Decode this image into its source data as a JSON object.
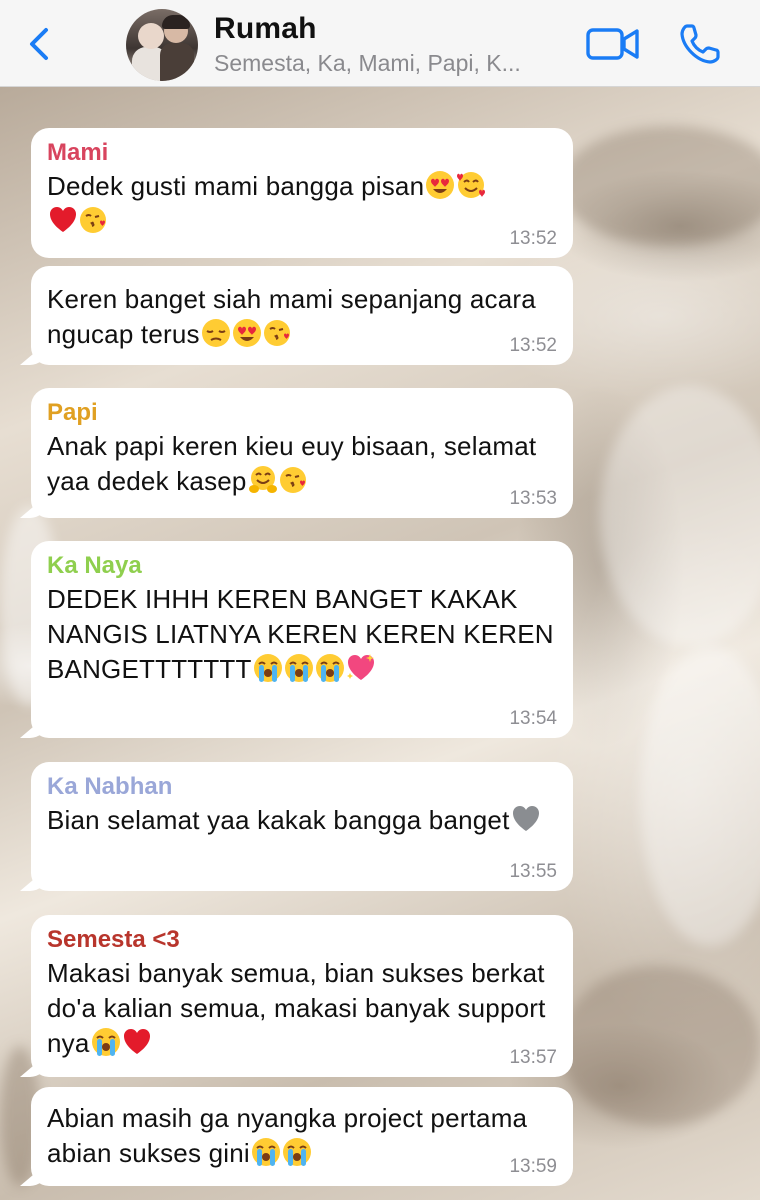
{
  "header": {
    "back_icon": "chevron-left-icon",
    "title": "Rumah",
    "subtitle": "Semesta, Ka, Mami, Papi, K...",
    "video_icon": "video-camera-icon",
    "call_icon": "phone-icon",
    "accent_color": "#1a7cf5"
  },
  "messages": [
    {
      "sender": "Mami",
      "sender_color": "#d8445e",
      "text": "Dedek gusti mami bangga pisan",
      "emojis": [
        "heart-eyes",
        "smiling-hearts",
        "red-heart",
        "kissing-heart"
      ],
      "time": "13:52"
    },
    {
      "sender": "",
      "text": "Keren banget siah mami sepanjang acara ngucap terus",
      "emojis": [
        "pensive",
        "heart-eyes",
        "kissing-heart"
      ],
      "time": "13:52"
    },
    {
      "sender": "Papi",
      "sender_color": "#e0a022",
      "text": "Anak papi keren kieu euy bisaan, selamat yaa dedek kasep",
      "emojis": [
        "hugging",
        "kissing-heart"
      ],
      "time": "13:53"
    },
    {
      "sender": "Ka Naya",
      "sender_color": "#8fcf4e",
      "text": "DEDEK IHHH KEREN BANGET KAKAK NANGIS LIATNYA KEREN KEREN KEREN BANGETTTTTTT",
      "emojis": [
        "loudly-crying",
        "loudly-crying",
        "loudly-crying",
        "sparkling-heart"
      ],
      "time": "13:54"
    },
    {
      "sender": "Ka Nabhan",
      "sender_color": "#9aa7d8",
      "text": "Bian selamat yaa kakak bangga banget",
      "emojis": [
        "grey-heart"
      ],
      "time": "13:55"
    },
    {
      "sender": "Semesta <3",
      "sender_color": "#b8352c",
      "text": "Makasi banyak semua, bian sukses berkat do'a kalian semua, makasi banyak support nya",
      "emojis": [
        "loudly-crying",
        "red-heart"
      ],
      "time": "13:57"
    },
    {
      "sender": "",
      "text": "Abian masih ga nyangka project pertama abian sukses gini",
      "emojis": [
        "loudly-crying",
        "loudly-crying"
      ],
      "time": "13:59"
    }
  ]
}
